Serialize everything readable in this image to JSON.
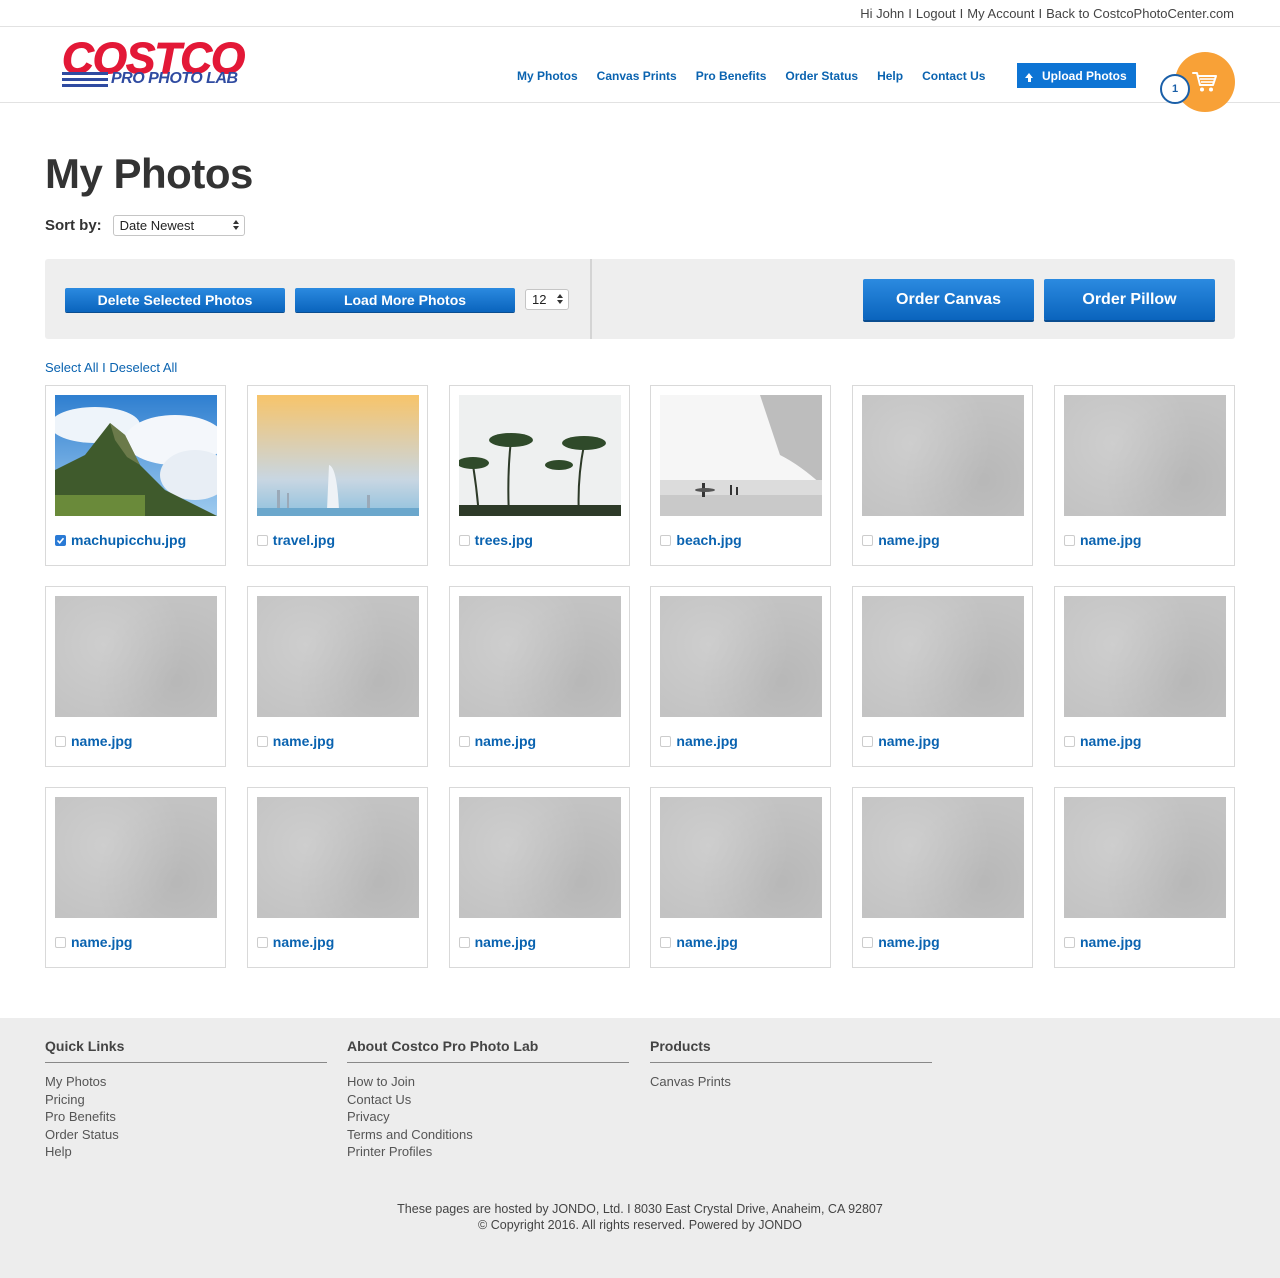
{
  "utility": {
    "greeting": "Hi John",
    "logout": "Logout",
    "account": "My Account",
    "back": "Back to CostcoPhotoCenter.com",
    "sep": "I"
  },
  "brand": {
    "main": "COSTCO",
    "sub": "PRO PHOTO LAB",
    "red": "#e31837",
    "blue": "#2f4ba1"
  },
  "nav": {
    "items": [
      "My Photos",
      "Canvas Prints",
      "Pro Benefits",
      "Order Status",
      "Help",
      "Contact Us"
    ],
    "upload_label": "Upload Photos",
    "cart_count": "1"
  },
  "page": {
    "title": "My Photos",
    "sort_label": "Sort by:",
    "sort_value": "Date Newest"
  },
  "actions": {
    "delete_label": "Delete Selected Photos",
    "load_label": "Load More Photos",
    "per_page": "12",
    "order_canvas": "Order Canvas",
    "order_pillow": "Order Pillow"
  },
  "selection": {
    "select_all": "Select All",
    "sep": "I",
    "deselect_all": "Deselect All"
  },
  "photos": [
    {
      "name": "machupicchu.jpg",
      "checked": true,
      "kind": "mountain"
    },
    {
      "name": "travel.jpg",
      "checked": false,
      "kind": "dubai"
    },
    {
      "name": "trees.jpg",
      "checked": false,
      "kind": "palms"
    },
    {
      "name": "beach.jpg",
      "checked": false,
      "kind": "beach"
    },
    {
      "name": "name.jpg",
      "checked": false,
      "kind": "placeholder"
    },
    {
      "name": "name.jpg",
      "checked": false,
      "kind": "placeholder"
    },
    {
      "name": "name.jpg",
      "checked": false,
      "kind": "placeholder"
    },
    {
      "name": "name.jpg",
      "checked": false,
      "kind": "placeholder"
    },
    {
      "name": "name.jpg",
      "checked": false,
      "kind": "placeholder"
    },
    {
      "name": "name.jpg",
      "checked": false,
      "kind": "placeholder"
    },
    {
      "name": "name.jpg",
      "checked": false,
      "kind": "placeholder"
    },
    {
      "name": "name.jpg",
      "checked": false,
      "kind": "placeholder"
    },
    {
      "name": "name.jpg",
      "checked": false,
      "kind": "placeholder"
    },
    {
      "name": "name.jpg",
      "checked": false,
      "kind": "placeholder"
    },
    {
      "name": "name.jpg",
      "checked": false,
      "kind": "placeholder"
    },
    {
      "name": "name.jpg",
      "checked": false,
      "kind": "placeholder"
    },
    {
      "name": "name.jpg",
      "checked": false,
      "kind": "placeholder"
    },
    {
      "name": "name.jpg",
      "checked": false,
      "kind": "placeholder"
    }
  ],
  "footer": {
    "quick_links": {
      "title": "Quick Links",
      "items": [
        "My Photos",
        "Pricing",
        "Pro Benefits",
        "Order Status",
        "Help"
      ]
    },
    "about": {
      "title": "About Costco Pro Photo Lab",
      "items": [
        "How to Join",
        "Contact Us",
        "Privacy",
        "Terms and Conditions",
        "Printer Profiles"
      ]
    },
    "products": {
      "title": "Products",
      "items": [
        "Canvas Prints"
      ]
    },
    "hosted": "These pages are hosted by JONDO, Ltd. I 8030 East Crystal Drive, Anaheim, CA 92807",
    "copyright": "© Copyright 2016. All rights reserved. Powered by JONDO"
  },
  "colors": {
    "link_blue": "#0a63b0",
    "button_blue": "#0d74d4",
    "cart_orange": "#f8a137",
    "footer_bg": "#ededed"
  }
}
